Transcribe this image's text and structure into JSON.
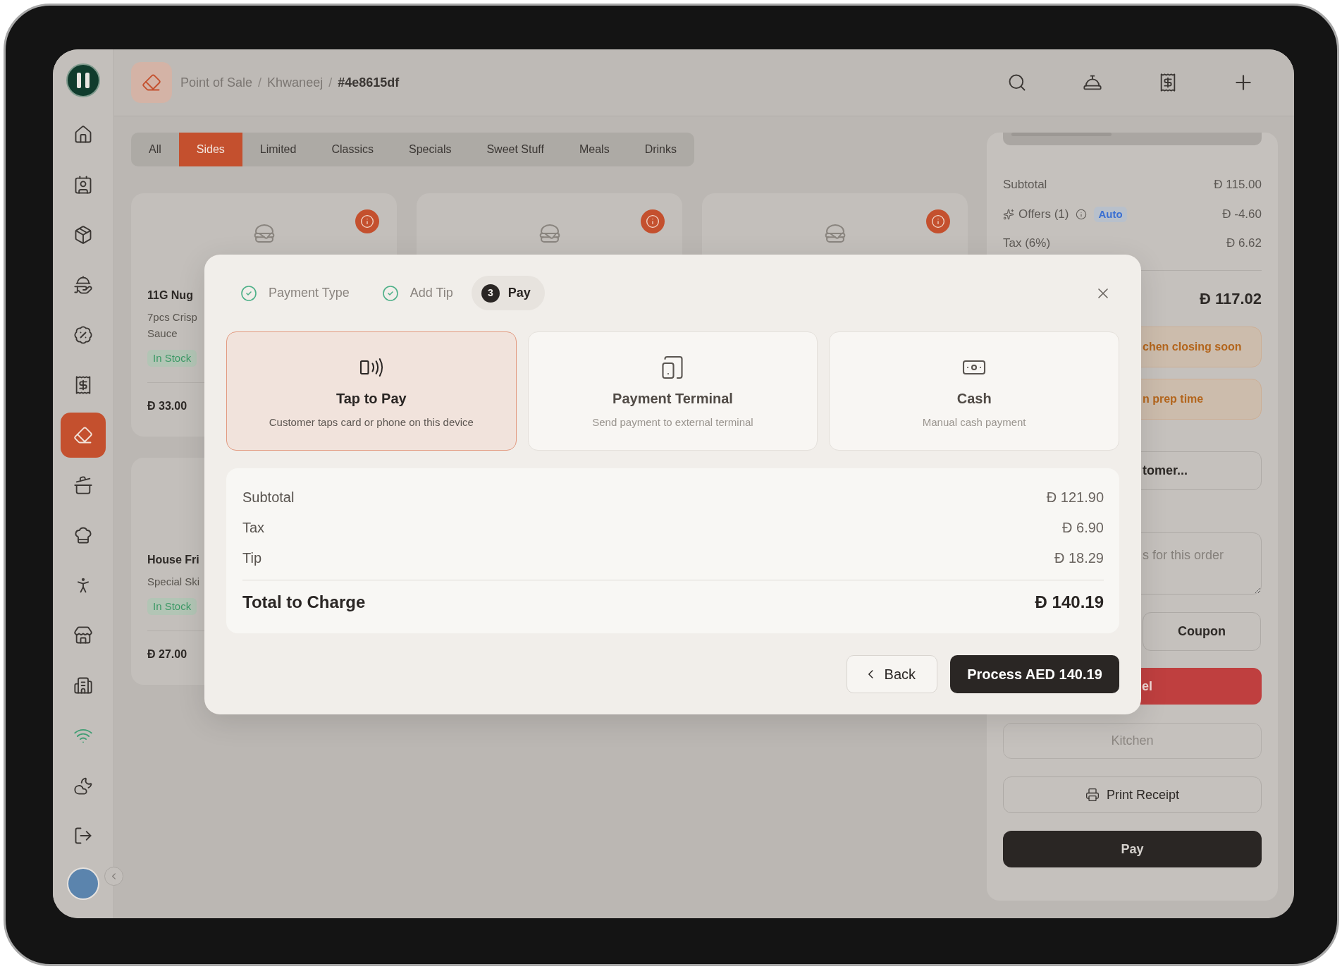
{
  "sidebar": {
    "items": [
      {
        "selected": false
      },
      {
        "selected": false
      },
      {
        "selected": false
      },
      {
        "selected": false
      },
      {
        "selected": false
      },
      {
        "selected": false
      },
      {
        "selected": true
      },
      {
        "selected": false
      },
      {
        "selected": false
      },
      {
        "selected": false
      },
      {
        "selected": false
      },
      {
        "selected": false
      },
      {
        "selected": false,
        "color": "#3f9d73"
      },
      {
        "selected": false
      },
      {
        "selected": false
      }
    ]
  },
  "header": {
    "breadcrumb": {
      "items": [
        "Point of Sale",
        "Khwaneej",
        "#4e8615df"
      ],
      "separators": [
        "/",
        "/"
      ]
    }
  },
  "category_tabs": [
    {
      "label": "All",
      "selected": false
    },
    {
      "label": "Sides",
      "selected": true
    },
    {
      "label": "Limited",
      "selected": false
    },
    {
      "label": "Classics",
      "selected": false
    },
    {
      "label": "Specials",
      "selected": false
    },
    {
      "label": "Sweet Stuff",
      "selected": false
    },
    {
      "label": "Meals",
      "selected": false
    },
    {
      "label": "Drinks",
      "selected": false
    }
  ],
  "products": [
    {
      "kind": "full",
      "name": "11G Nug",
      "description_lines": [
        "7pcs Crisp",
        "Sauce"
      ],
      "stock": "In Stock",
      "price": "Ð 33.00"
    },
    {
      "kind": "image_only"
    },
    {
      "kind": "image_only"
    },
    {
      "kind": "text_only",
      "name": "House Fri",
      "description_lines": [
        "Special Ski"
      ],
      "stock": "In Stock",
      "price": "Ð 27.00"
    }
  ],
  "order_panel": {
    "summary": [
      {
        "kind": "plain",
        "label": "Subtotal",
        "value": "Ð 115.00"
      },
      {
        "kind": "offer",
        "label": "Offers (1)",
        "badge": "Auto",
        "value": "Ð -4.60"
      },
      {
        "kind": "plain",
        "label": "Tax (6%)",
        "value": "Ð 6.62"
      }
    ],
    "total_value": "Ð 117.02",
    "alerts": [
      "chen closing soon",
      "n prep time"
    ],
    "customer_button": "tomer...",
    "notes_placeholder": "s for this order",
    "coupon_button": "Coupon",
    "cancel_button": "el",
    "kitchen_button": {
      "label": "Kitchen",
      "disabled": true
    },
    "print_button": "Print Receipt",
    "pay_button": "Pay"
  },
  "payment_modal": {
    "steps": [
      {
        "label": "Payment Type",
        "done": true,
        "selected": false
      },
      {
        "label": "Add Tip",
        "done": true,
        "selected": false
      },
      {
        "label": "Pay",
        "number": "3",
        "done": false,
        "selected": true
      }
    ],
    "methods": [
      {
        "title": "Tap to Pay",
        "description": "Customer taps card or phone on this device",
        "selected": true
      },
      {
        "title": "Payment Terminal",
        "description": "Send payment to external terminal",
        "selected": false
      },
      {
        "title": "Cash",
        "description": "Manual cash payment",
        "selected": false
      }
    ],
    "summary": [
      {
        "label": "Subtotal",
        "value": "Ð 121.90"
      },
      {
        "label": "Tax",
        "value": "Ð 6.90"
      },
      {
        "label": "Tip",
        "value": "Ð 18.29"
      }
    ],
    "total": {
      "label": "Total to Charge",
      "value": "Ð 140.19"
    },
    "back_button": "Back",
    "process_button": "Process AED 140.19"
  }
}
